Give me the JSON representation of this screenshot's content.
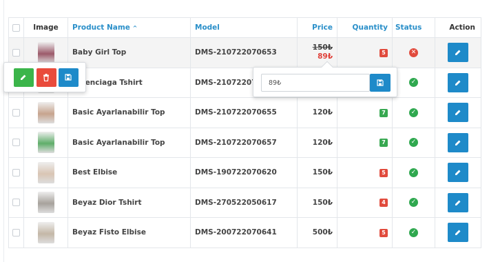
{
  "table": {
    "headers": {
      "image": "Image",
      "product_name": "Product Name",
      "sort_indicator": "^",
      "model": "Model",
      "price": "Price",
      "quantity": "Quantity",
      "status": "Status",
      "action": "Action"
    },
    "rows": [
      {
        "name": "Baby Girl Top",
        "model": "DMS-210722070653",
        "price_old": "150₺",
        "price_new": "89₺",
        "quantity": "5",
        "quantity_color": "#e14b3d",
        "status": "disabled",
        "thumb_color": "#9c5a6a"
      },
      {
        "name": "Balenciaga Tshirt",
        "model": "DMS-210722070654",
        "price": "",
        "quantity": "",
        "quantity_color": "#38a851",
        "status": "enabled",
        "thumb_color": "#b99a86"
      },
      {
        "name": "Basic Ayarlanabilir Top",
        "model": "DMS-210722070655",
        "price": "120₺",
        "quantity": "7",
        "quantity_color": "#38a851",
        "status": "enabled",
        "thumb_color": "#c7a48e"
      },
      {
        "name": "Basic Ayarlanabilir Top",
        "model": "DMS-210722070657",
        "price": "120₺",
        "quantity": "7",
        "quantity_color": "#38a851",
        "status": "enabled",
        "thumb_color": "#5fae6a"
      },
      {
        "name": "Best Elbise",
        "model": "DMS-190722070620",
        "price": "150₺",
        "quantity": "5",
        "quantity_color": "#e14b3d",
        "status": "enabled",
        "thumb_color": "#d9c5b4"
      },
      {
        "name": "Beyaz Dior Tshirt",
        "model": "DMS-270522050617",
        "price": "150₺",
        "quantity": "4",
        "quantity_color": "#e14b3d",
        "status": "enabled",
        "thumb_color": "#a7a29c"
      },
      {
        "name": "Beyaz Fisto Elbise",
        "model": "DMS-200722070641",
        "price": "500₺",
        "quantity": "5",
        "quantity_color": "#e14b3d",
        "status": "enabled",
        "thumb_color": "#c4b7a7"
      }
    ]
  },
  "price_popover": {
    "value": "89₺"
  },
  "colors": {
    "accent": "#1e8ac9",
    "success": "#3bb54a",
    "danger": "#e94b3c"
  },
  "icons": {
    "edit": "pencil-icon",
    "delete": "trash-icon",
    "save": "floppy-disk-icon",
    "ok": "check-circle-icon",
    "disabled": "x-circle-icon"
  }
}
